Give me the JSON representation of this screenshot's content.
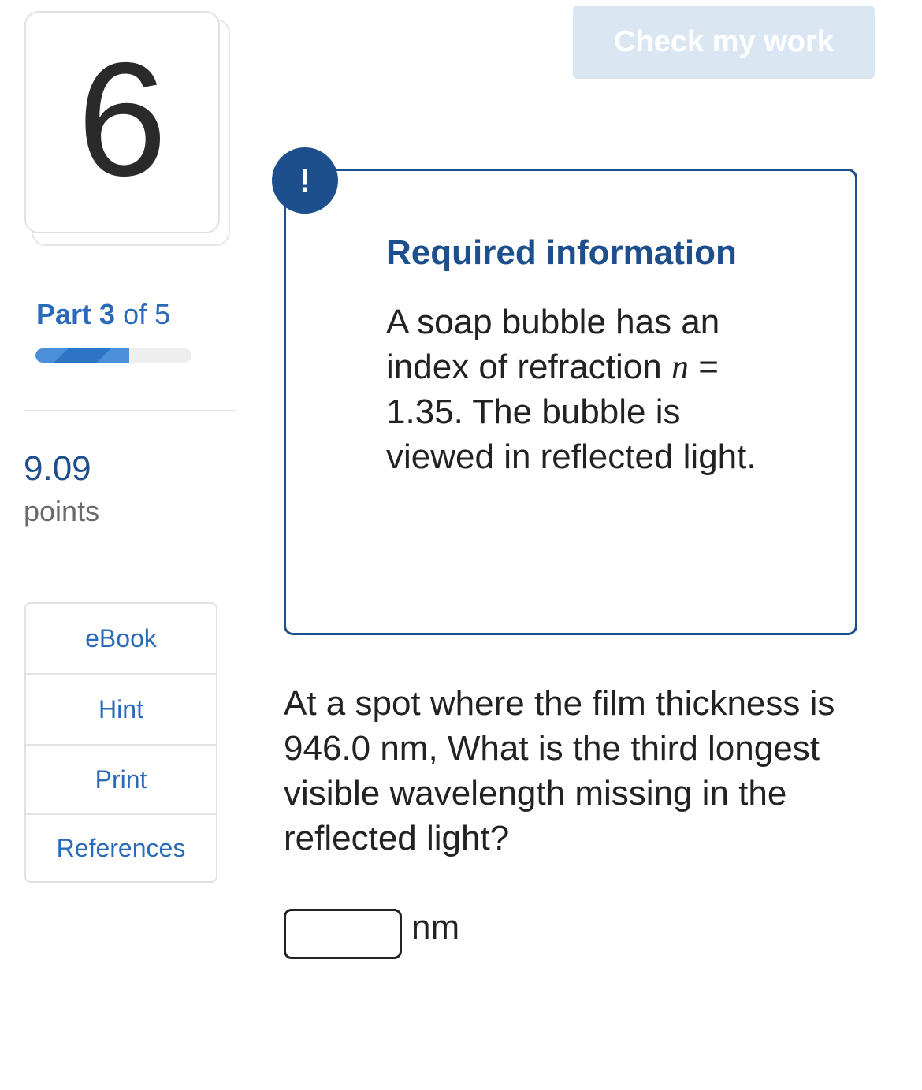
{
  "question": {
    "number": "6",
    "part_label": "Part",
    "part_current": "3",
    "part_of": "of 5",
    "progress_fraction": 0.6,
    "points_value": "9.09",
    "points_label": "points"
  },
  "tools": [
    {
      "label": "eBook"
    },
    {
      "label": "Hint"
    },
    {
      "label": "Print"
    },
    {
      "label": "References"
    }
  ],
  "header": {
    "check_button_label": "Check my work"
  },
  "required_info": {
    "badge": "!",
    "title": "Required information",
    "body_prefix": "A soap bubble has an index of refraction ",
    "variable": "n",
    "body_suffix": " = 1.35. The bubble is viewed in reflected light."
  },
  "main": {
    "question_text": "At a spot where the film thickness is 946.0 nm, What is the third longest visible wavelength missing in the reflected light?",
    "answer_value": "",
    "answer_unit": "nm"
  },
  "colors": {
    "brand_dark": "#1d4f8c",
    "link_blue": "#2a6ab8",
    "button_disabled": "#dbe6f3"
  }
}
